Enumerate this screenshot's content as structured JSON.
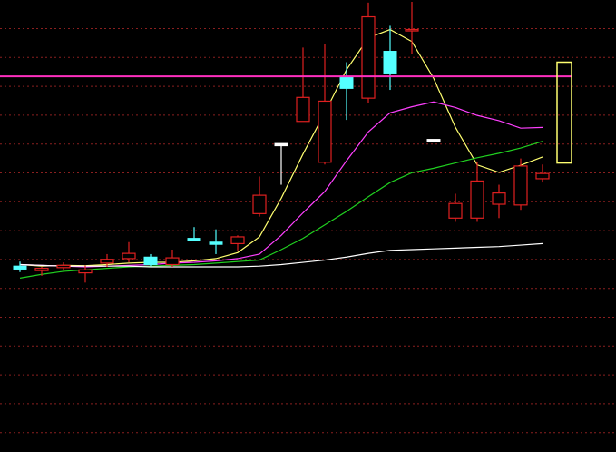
{
  "chart_data": {
    "type": "candlestick",
    "title": "",
    "xlabel": "",
    "ylabel": "",
    "ylim": [
      0,
      100
    ],
    "grid": true,
    "colors": {
      "background": "#000000",
      "grid": "#8a1f1f",
      "up": "#e02020",
      "down": "#54ffff",
      "flat": "#ffffff",
      "highlight_line": "#ff2fbf",
      "highlight_box": "#ffff70"
    },
    "candles": [
      {
        "x": 1,
        "open": 29.5,
        "high": 30.7,
        "low": 27.9,
        "close": 28.7,
        "dir": "down"
      },
      {
        "x": 2,
        "open": 28.3,
        "high": 29.3,
        "low": 26.9,
        "close": 28.9,
        "dir": "up"
      },
      {
        "x": 3,
        "open": 29.1,
        "high": 30.5,
        "low": 28.3,
        "close": 29.7,
        "dir": "up"
      },
      {
        "x": 4,
        "open": 27.7,
        "high": 29.7,
        "low": 25.1,
        "close": 28.5,
        "dir": "up"
      },
      {
        "x": 5,
        "open": 30.3,
        "high": 32.7,
        "low": 29.3,
        "close": 31.3,
        "dir": "up"
      },
      {
        "x": 6,
        "open": 31.5,
        "high": 35.9,
        "low": 30.5,
        "close": 32.9,
        "dir": "up"
      },
      {
        "x": 7,
        "open": 31.9,
        "high": 32.7,
        "low": 29.5,
        "close": 29.9,
        "dir": "down"
      },
      {
        "x": 8,
        "open": 29.9,
        "high": 33.9,
        "low": 29.3,
        "close": 31.7,
        "dir": "up"
      },
      {
        "x": 9,
        "open": 36.9,
        "high": 39.9,
        "low": 36.5,
        "close": 36.5,
        "dir": "down"
      },
      {
        "x": 10,
        "open": 35.9,
        "high": 39.3,
        "low": 32.7,
        "close": 35.5,
        "dir": "down"
      },
      {
        "x": 11,
        "open": 35.5,
        "high": 37.7,
        "low": 33.7,
        "close": 37.3,
        "dir": "up"
      },
      {
        "x": 12,
        "open": 43.5,
        "high": 53.4,
        "low": 42.7,
        "close": 48.4,
        "dir": "up"
      },
      {
        "x": 13,
        "open": 62.2,
        "high": 62.2,
        "low": 51.2,
        "close": 62.2,
        "dir": "flat"
      },
      {
        "x": 14,
        "open": 68.1,
        "high": 87.8,
        "low": 68.1,
        "close": 74.5,
        "dir": "up"
      },
      {
        "x": 15,
        "open": 57.2,
        "high": 88.8,
        "low": 56.6,
        "close": 73.5,
        "dir": "up"
      },
      {
        "x": 16,
        "open": 80.1,
        "high": 83.9,
        "low": 68.5,
        "close": 76.9,
        "dir": "down"
      },
      {
        "x": 17,
        "open": 74.3,
        "high": 99.8,
        "low": 73.1,
        "close": 96.0,
        "dir": "up"
      },
      {
        "x": 18,
        "open": 86.8,
        "high": 93.6,
        "low": 76.5,
        "close": 81.0,
        "dir": "down"
      },
      {
        "x": 19,
        "open": 92.6,
        "high": 100.0,
        "low": 86.2,
        "close": 92.6,
        "dir": "up"
      },
      {
        "x": 20,
        "open": 63.3,
        "high": 63.3,
        "low": 63.3,
        "close": 63.3,
        "dir": "flat"
      },
      {
        "x": 21,
        "open": 42.3,
        "high": 48.8,
        "low": 41.3,
        "close": 46.2,
        "dir": "up"
      },
      {
        "x": 22,
        "open": 42.3,
        "high": 57.4,
        "low": 41.3,
        "close": 52.2,
        "dir": "up"
      },
      {
        "x": 23,
        "open": 46.0,
        "high": 51.2,
        "low": 42.3,
        "close": 49.0,
        "dir": "up"
      },
      {
        "x": 24,
        "open": 45.8,
        "high": 58.2,
        "low": 44.5,
        "close": 56.2,
        "dir": "up"
      },
      {
        "x": 25,
        "open": 52.8,
        "high": 56.6,
        "low": 51.8,
        "close": 54.2,
        "dir": "up"
      }
    ],
    "series": [
      {
        "color": "#ffff70",
        "values": [
          29.9,
          29.5,
          29.7,
          29.6,
          29.9,
          30.3,
          30.5,
          30.5,
          30.9,
          31.5,
          33.1,
          37.3,
          47.6,
          59.4,
          70.4,
          81.9,
          90.4,
          92.6,
          89.4,
          79.6,
          66.5,
          56.5,
          54.5,
          56.4,
          58.6
        ]
      },
      {
        "color": "#ff40ff",
        "values": [
          29.9,
          29.7,
          29.5,
          29.3,
          29.5,
          29.7,
          29.9,
          30.3,
          30.5,
          30.9,
          31.5,
          32.7,
          37.7,
          43.7,
          49.4,
          57.6,
          65.3,
          70.4,
          72.0,
          73.3,
          71.8,
          69.7,
          68.3,
          66.3,
          66.5
        ]
      },
      {
        "color": "#20d020",
        "values": [
          26.3,
          27.3,
          28.1,
          28.5,
          28.9,
          29.3,
          29.5,
          29.7,
          29.9,
          30.3,
          30.7,
          31.1,
          33.9,
          36.9,
          40.5,
          44.1,
          48.0,
          51.8,
          54.4,
          55.6,
          57.0,
          58.4,
          59.6,
          61.0,
          62.8
        ]
      },
      {
        "color": "#ffffff",
        "values": [
          29.9,
          29.7,
          29.5,
          29.5,
          29.5,
          29.5,
          29.3,
          29.3,
          29.3,
          29.3,
          29.3,
          29.5,
          29.9,
          30.5,
          31.1,
          31.9,
          32.9,
          33.7,
          33.9,
          34.1,
          34.3,
          34.5,
          34.7,
          35.1,
          35.5
        ]
      }
    ],
    "highlight_level": 80.1,
    "highlight_box": {
      "x": 26,
      "top": 83.9,
      "bottom": 57.0
    }
  }
}
